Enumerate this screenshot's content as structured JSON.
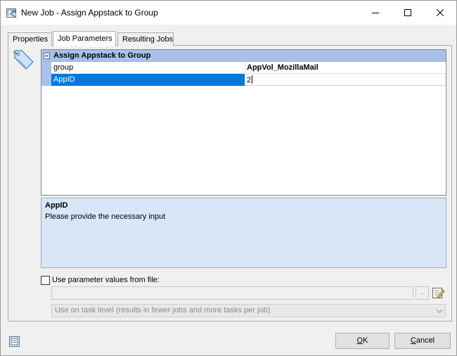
{
  "window": {
    "title": "New Job - Assign Appstack to Group"
  },
  "tabs": [
    {
      "label": "Properties"
    },
    {
      "label": "Job Parameters"
    },
    {
      "label": "Resulting Jobs"
    }
  ],
  "grid": {
    "category": "Assign Appstack to Group",
    "rows": [
      {
        "name": "group",
        "value": "AppVol_MozillaMail"
      },
      {
        "name": "AppID",
        "value": "2"
      }
    ]
  },
  "description": {
    "title": "AppID",
    "text": "Please provide the necessary input"
  },
  "file_option": {
    "label": "Use parameter values from file:",
    "checked": false,
    "path_value": "",
    "browse_label": "...",
    "level_selected": "Use on task level (results in fewer jobs and more tasks per job)"
  },
  "buttons": {
    "ok": {
      "underlined": "O",
      "rest": "K"
    },
    "cancel": {
      "underlined": "C",
      "rest": "ancel"
    }
  },
  "colors": {
    "selection": "#0078d7",
    "header": "#a7c1ea",
    "description_bg": "#d9e6f7"
  }
}
